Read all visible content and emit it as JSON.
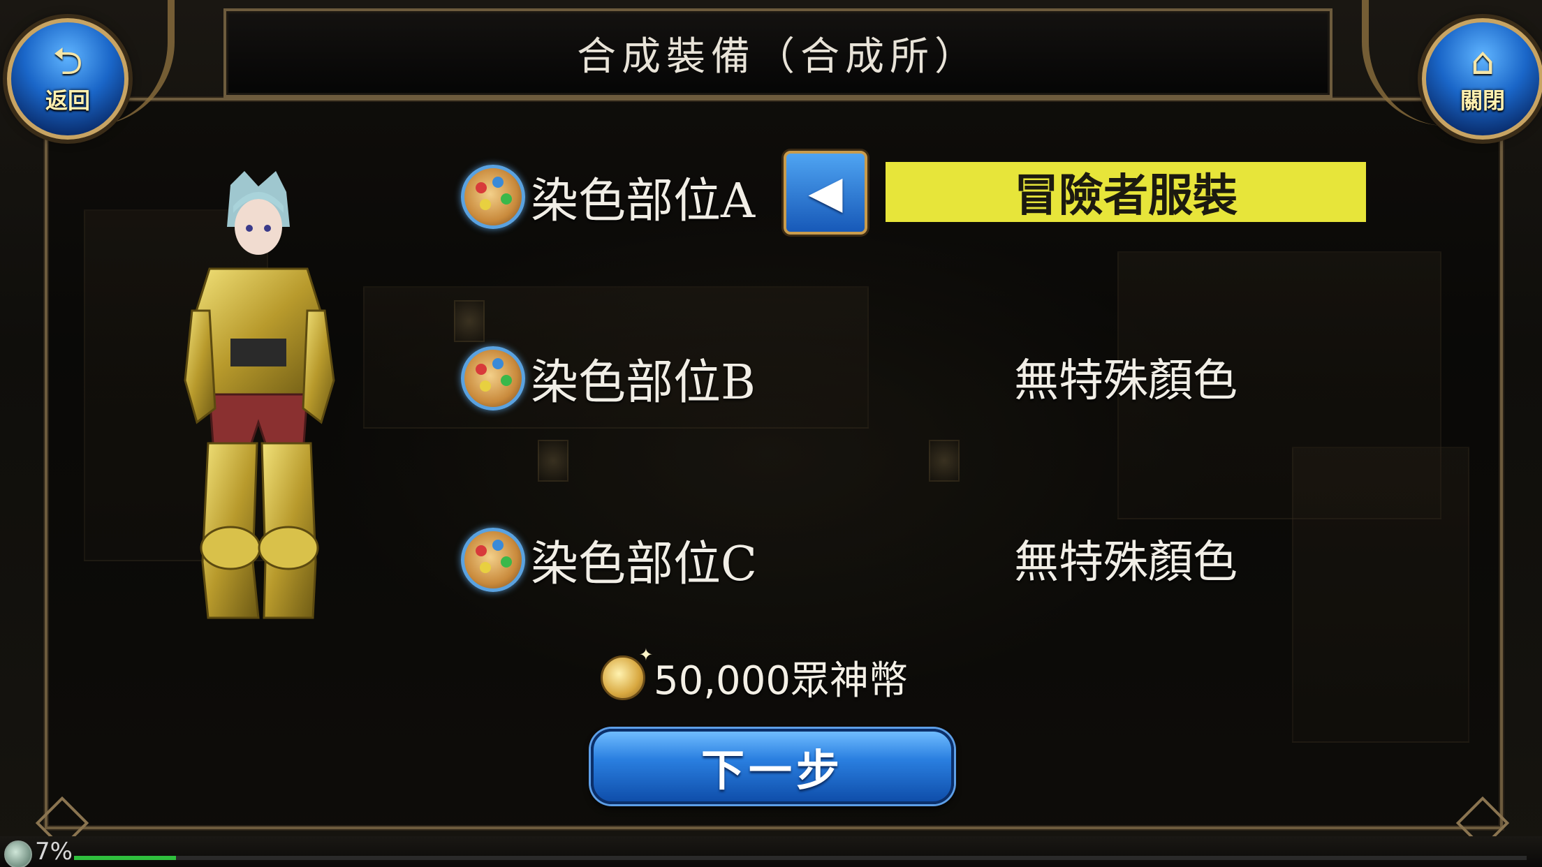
{
  "window": {
    "title": "合成裝備（合成所）"
  },
  "nav": {
    "back_label": "返回",
    "close_label": "關閉"
  },
  "dye_slots": [
    {
      "label": "染色部位A",
      "value": "冒險者服裝",
      "highlighted": true
    },
    {
      "label": "染色部位B",
      "value": "無特殊顏色",
      "highlighted": false
    },
    {
      "label": "染色部位C",
      "value": "無特殊顏色",
      "highlighted": false
    }
  ],
  "cost": {
    "text": "50,000眾神幣"
  },
  "actions": {
    "next_label": "下一步"
  },
  "loading": {
    "progress_text": "7%",
    "progress_fraction": 0.07
  },
  "colors": {
    "highlight": "#e7e53a",
    "button_blue": "#2a7fe0",
    "frame_gold": "#6d5b3d",
    "progress_green": "#2fbf3e"
  },
  "icons": {
    "back": "return-arrow-icon",
    "close": "home-icon",
    "slot": "palette-icon",
    "prev": "left-triangle-icon",
    "cost": "coins-icon"
  }
}
